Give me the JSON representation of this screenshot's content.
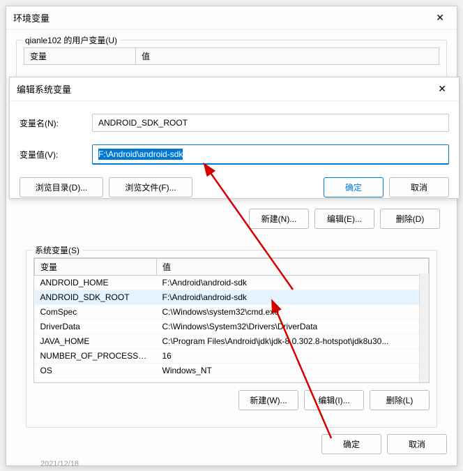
{
  "env_window": {
    "title": "环境变量",
    "user_group_label": "qianle102 的用户变量(U)",
    "sys_group_label": "系统变量(S)",
    "headers": {
      "var": "变量",
      "val": "值"
    },
    "user_buttons": {
      "new": "新建(N)...",
      "edit": "编辑(E)...",
      "del": "删除(D)"
    },
    "sys_buttons": {
      "new": "新建(W)...",
      "edit": "编辑(I)...",
      "del": "删除(L)"
    },
    "ok": "确定",
    "cancel": "取消",
    "sys_vars": [
      {
        "name": "ANDROID_HOME",
        "value": "F:\\Android\\android-sdk"
      },
      {
        "name": "ANDROID_SDK_ROOT",
        "value": "F:\\Android\\android-sdk",
        "selected": true
      },
      {
        "name": "ComSpec",
        "value": "C:\\Windows\\system32\\cmd.exe"
      },
      {
        "name": "DriverData",
        "value": "C:\\Windows\\System32\\Drivers\\DriverData"
      },
      {
        "name": "JAVA_HOME",
        "value": "C:\\Program Files\\Android\\jdk\\jdk-8.0.302.8-hotspot\\jdk8u30..."
      },
      {
        "name": "NUMBER_OF_PROCESSORS",
        "value": "16"
      },
      {
        "name": "OS",
        "value": "Windows_NT"
      }
    ]
  },
  "edit_window": {
    "title": "编辑系统变量",
    "name_label": "变量名(N):",
    "value_label": "变量值(V):",
    "name_value": "ANDROID_SDK_ROOT",
    "value_value": "F:\\Android\\android-sdk",
    "browse_dir": "浏览目录(D)...",
    "browse_file": "浏览文件(F)...",
    "ok": "确定",
    "cancel": "取消"
  },
  "footer_date": "2021/12/18"
}
